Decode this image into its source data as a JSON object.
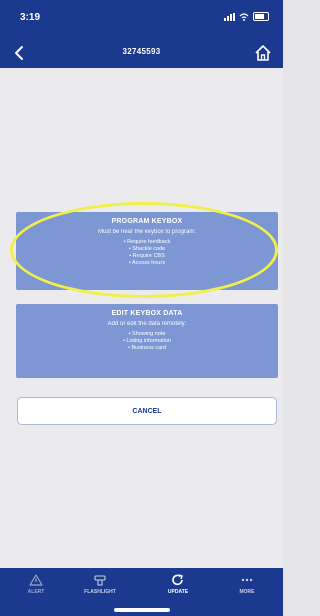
{
  "status_bar": {
    "time": "3:19"
  },
  "header": {
    "title": "32745593"
  },
  "program_card": {
    "title": "PROGRAM KEYBOX",
    "subtitle": "Must be near the keybox to program:",
    "items": [
      "• Require feedback",
      "• Shackle code",
      "• Require CBS",
      "• Access hours"
    ]
  },
  "edit_card": {
    "title": "EDIT KEYBOX DATA",
    "subtitle": "Add or edit the data remotely:",
    "items": [
      "• Showing note",
      "• Listing information",
      "• Business card"
    ]
  },
  "cancel_label": "CANCEL",
  "tabs": [
    {
      "label": "ALERT",
      "icon": "alert-icon"
    },
    {
      "label": "FLASHLIGHT",
      "icon": "flashlight-icon"
    },
    {
      "label": "UPDATE",
      "icon": "update-icon"
    },
    {
      "label": "MORE",
      "icon": "more-icon"
    }
  ],
  "colors": {
    "primary": "#1b3a8f",
    "card": "#7c97d3",
    "highlight": "#f1f04a"
  }
}
